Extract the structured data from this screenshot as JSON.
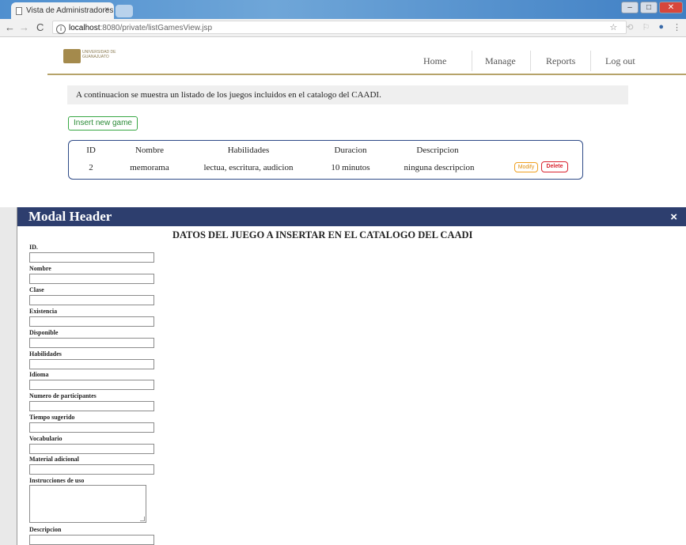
{
  "browser": {
    "tab_title": "Vista de Administradores",
    "tab_close": "×",
    "url_host": "localhost",
    "url_rest": ":8080/private/listGamesView.jsp",
    "window_controls": [
      "–",
      "□",
      "✕"
    ],
    "back_icon": "arrow-left",
    "forward_icon": "arrow-right",
    "reload_icon": "reload",
    "star_icon": "star"
  },
  "site": {
    "logo_text_line1": "UNIVERSIDAD DE",
    "logo_text_line2": "GUANAJUATO",
    "nav": {
      "home": "Home",
      "manage": "Manage",
      "reports": "Reports",
      "logout": "Log out"
    }
  },
  "intro_text": "A continuacion se muestra un listado de los juegos incluidos en el catalogo del CAADI.",
  "insert_button": "Insert new game",
  "games_table": {
    "headers": [
      "ID",
      "Nombre",
      "Habilidades",
      "Duracion",
      "Descripcion"
    ],
    "rows": [
      {
        "id": "2",
        "nombre": "memorama",
        "habilidades": "lectua, escritura, audicion",
        "duracion": "10 minutos",
        "descripcion": "ninguna descripcion",
        "modify_label": "Modify",
        "delete_label": "Delete"
      }
    ]
  },
  "modal": {
    "title": "Modal Header",
    "close": "×",
    "form_heading": "DATOS DEL JUEGO A INSERTAR EN EL CATALOGO DEL CAADI",
    "fields": [
      "ID.",
      "Nombre",
      "Clase",
      "Existencia",
      "Disponible",
      "Habilidades",
      "Idioma",
      "Numero de participantes",
      "Tiempo sugerido",
      "Vocabulario",
      "Material adicional",
      "Instrucciones de uso",
      "Descripcion"
    ]
  },
  "colors": {
    "modal_header": "#2d3e6e",
    "header_rule": "#b6a36a",
    "insert_green": "#38a844",
    "delete_red": "#d9232e",
    "modify_orange": "#f0a020",
    "table_border": "#2e4a87"
  }
}
